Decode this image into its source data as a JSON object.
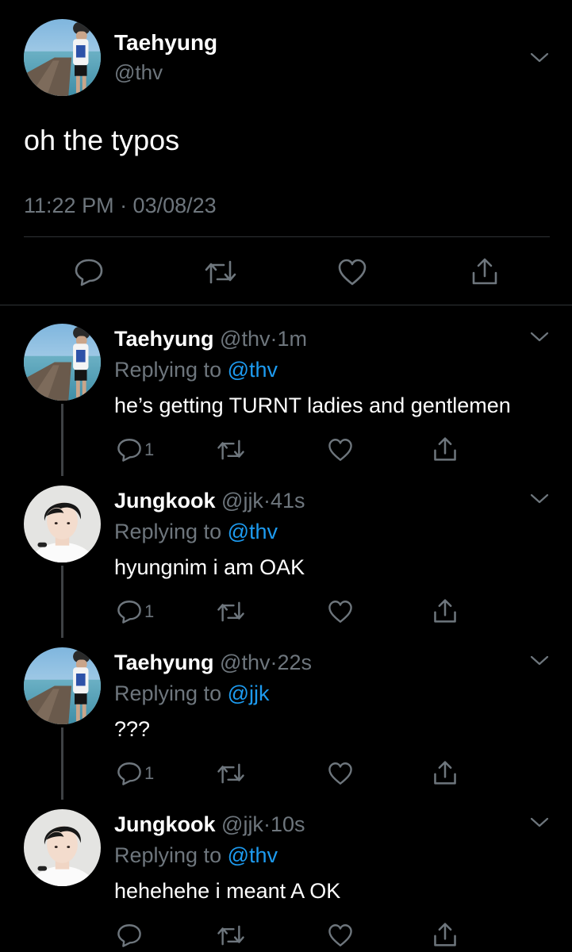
{
  "colors": {
    "background": "#000000",
    "text": "#ffffff",
    "secondary": "#6e767d",
    "accent": "#1d9bf0",
    "divider": "#2f3336"
  },
  "main_tweet": {
    "avatar": "profile-photo-pier",
    "name": "Taehyung",
    "handle": "@thv",
    "text": "oh the typos",
    "timestamp": "11:22 PM · 03/08/23",
    "actions": [
      "reply-icon",
      "retweet-icon",
      "like-icon",
      "share-icon"
    ]
  },
  "replies": [
    {
      "avatar": "profile-photo-pier",
      "name": "Taehyung",
      "handle": "@thv",
      "dot": "·",
      "age": "1m",
      "replying_label": "Replying to",
      "replying_to": "@thv",
      "text": "he’s getting TURNT ladies and gentlemen",
      "reply_count": "1"
    },
    {
      "avatar": "profile-photo-portrait",
      "name": "Jungkook",
      "handle": "@jjk",
      "dot": "·",
      "age": "41s",
      "replying_label": "Replying to",
      "replying_to": "@thv",
      "text": "hyungnim i am OAK",
      "reply_count": "1"
    },
    {
      "avatar": "profile-photo-pier",
      "name": "Taehyung",
      "handle": "@thv",
      "dot": "·",
      "age": "22s",
      "replying_label": "Replying to",
      "replying_to": "@jjk",
      "text": "???",
      "reply_count": "1"
    },
    {
      "avatar": "profile-photo-portrait",
      "name": "Jungkook",
      "handle": "@jjk",
      "dot": "·",
      "age": "10s",
      "replying_label": "Replying to",
      "replying_to": "@thv",
      "text": "hehehehe i meant A OK",
      "reply_count": ""
    }
  ]
}
